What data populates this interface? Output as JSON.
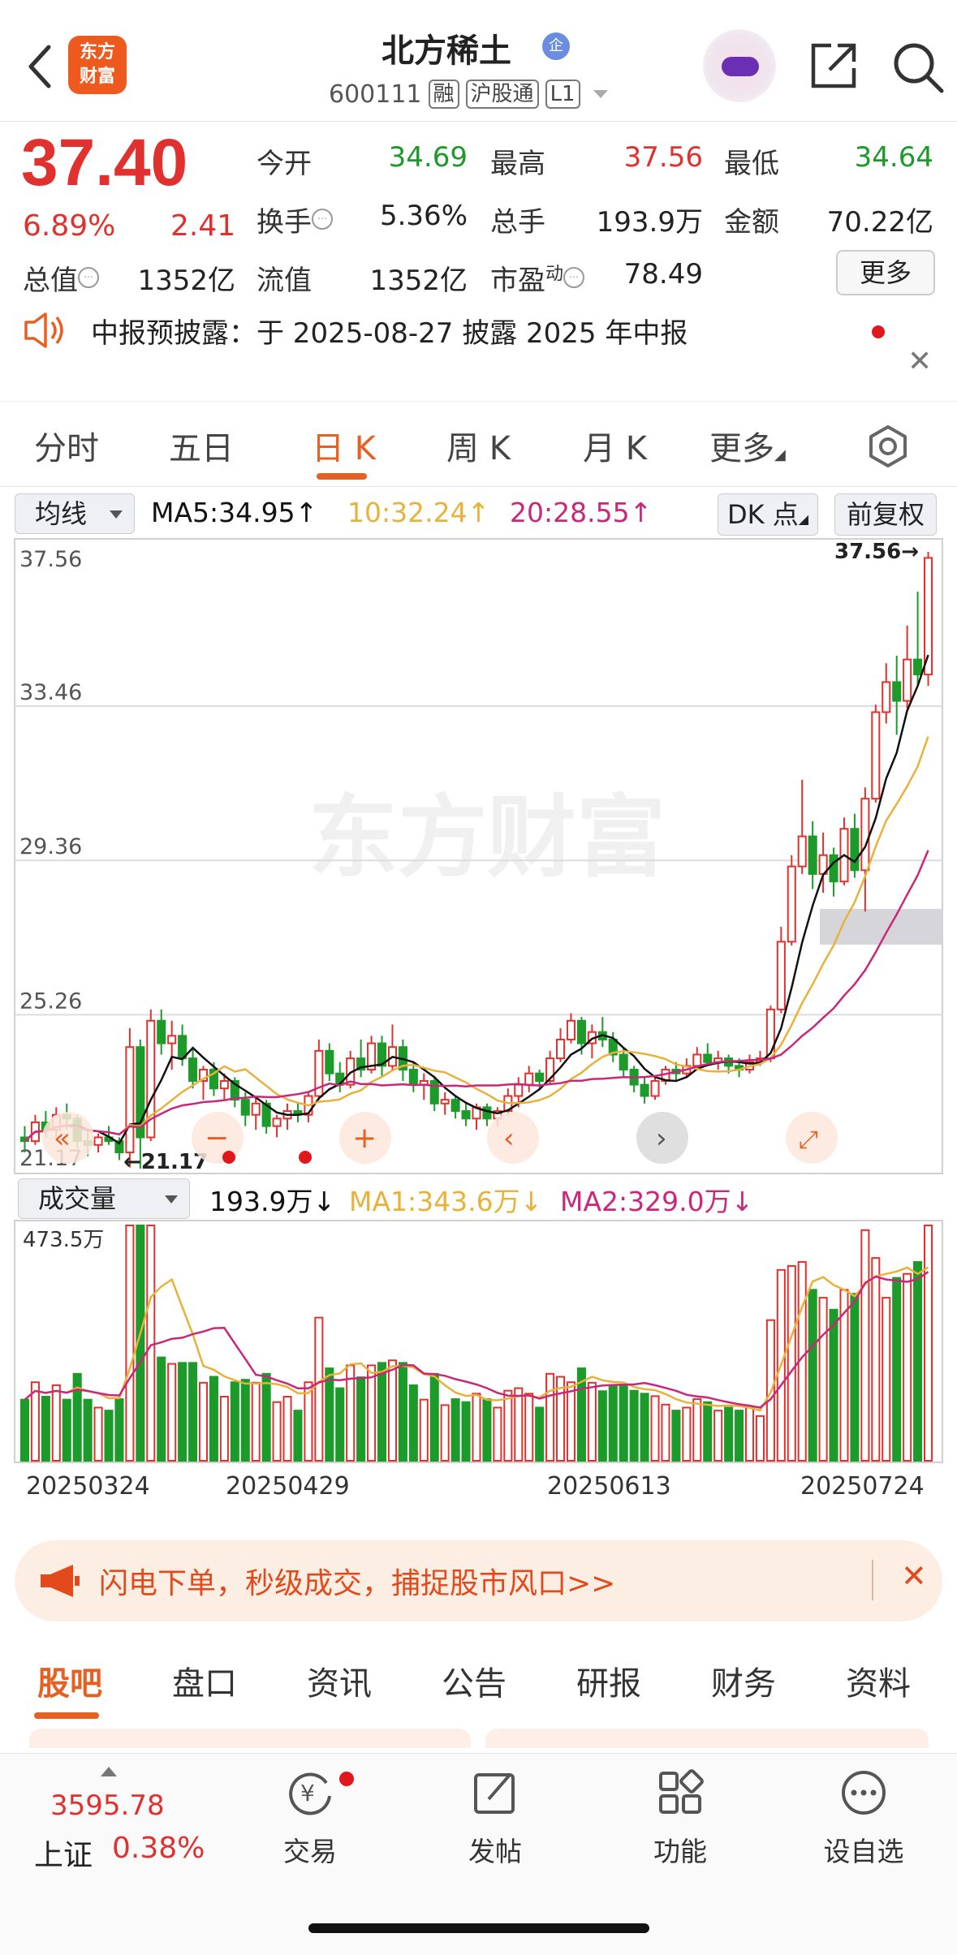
{
  "header": {
    "logo_text_line1": "东方",
    "logo_text_line2": "财富",
    "stock_name": "北方稀土",
    "cert_badge": "企",
    "stock_code": "600111",
    "tags": [
      "融",
      "沪股通",
      "L1"
    ]
  },
  "quote": {
    "price": "37.40",
    "change_pct": "6.89%",
    "change_amt": "2.41",
    "fields": [
      {
        "label": "今开",
        "value": "34.69",
        "color": "green"
      },
      {
        "label": "最高",
        "value": "37.56",
        "color": "red"
      },
      {
        "label": "最低",
        "value": "34.64",
        "color": "green"
      },
      {
        "label": "换手",
        "value": "5.36%",
        "color": "black"
      },
      {
        "label": "总手",
        "value": "193.9万",
        "color": "black"
      },
      {
        "label": "金额",
        "value": "70.22亿",
        "color": "black"
      },
      {
        "label": "总值",
        "value": "1352亿",
        "color": "black"
      },
      {
        "label": "流值",
        "value": "1352亿",
        "color": "black"
      },
      {
        "label": "市盈",
        "label_sup": "动",
        "value": "78.49",
        "color": "black"
      }
    ],
    "more_button": "更多"
  },
  "notice": {
    "text": "中报预披露：于 2025-08-27 披露 2025 年中报"
  },
  "chart_tabs": {
    "items": [
      "分时",
      "五日",
      "日 K",
      "周 K",
      "月 K",
      "更多"
    ],
    "active_index": 2
  },
  "ma_row": {
    "indicator": "均线",
    "ma5": "MA5:34.95",
    "ma10": "10:32.24",
    "ma20": "20:28.55",
    "dk_button": "DK 点",
    "adjust_button": "前复权",
    "colors": {
      "ma5": "#111111",
      "ma10": "#e8b23a",
      "ma20": "#c9287a"
    }
  },
  "kline": {
    "y_labels": [
      "37.56",
      "33.46",
      "29.36",
      "25.26",
      "21.17"
    ],
    "max_marker": "37.56",
    "min_marker": "21.17",
    "watermark": "东方财富",
    "up_color": "#e0312e",
    "down_color": "#1c9a2a"
  },
  "volume_row": {
    "indicator": "成交量",
    "value": "193.9万",
    "ma1": "MA1:343.6万",
    "ma2": "MA2:329.0万",
    "y_max_label": "473.5万"
  },
  "date_labels": [
    "20250324",
    "20250429",
    "20250613",
    "20250724"
  ],
  "chart_data": {
    "type": "candlestick",
    "ylim": [
      21.17,
      37.56
    ],
    "candles": [
      [
        22.0,
        22.3,
        21.6,
        21.9
      ],
      [
        21.9,
        22.6,
        21.8,
        22.4
      ],
      [
        22.4,
        22.7,
        22.0,
        22.2
      ],
      [
        22.2,
        22.8,
        22.0,
        22.6
      ],
      [
        22.6,
        22.9,
        22.2,
        22.5
      ],
      [
        22.5,
        22.6,
        21.7,
        21.9
      ],
      [
        21.9,
        22.2,
        21.5,
        21.8
      ],
      [
        21.8,
        22.1,
        21.6,
        22.0
      ],
      [
        22.0,
        22.3,
        21.8,
        21.9
      ],
      [
        21.9,
        22.0,
        21.4,
        21.6
      ],
      [
        21.6,
        24.9,
        21.2,
        24.4
      ],
      [
        24.4,
        24.6,
        21.17,
        22.0
      ],
      [
        22.0,
        25.4,
        21.9,
        25.1
      ],
      [
        25.1,
        25.4,
        24.2,
        24.5
      ],
      [
        24.5,
        25.1,
        23.8,
        24.7
      ],
      [
        24.7,
        25.0,
        23.9,
        24.1
      ],
      [
        24.1,
        24.4,
        23.3,
        23.5
      ],
      [
        23.5,
        23.9,
        23.0,
        23.8
      ],
      [
        23.8,
        24.0,
        23.1,
        23.3
      ],
      [
        23.3,
        23.7,
        23.0,
        23.5
      ],
      [
        23.5,
        23.6,
        22.8,
        23.0
      ],
      [
        23.0,
        23.2,
        22.3,
        22.6
      ],
      [
        22.6,
        23.1,
        22.2,
        22.9
      ],
      [
        22.9,
        23.0,
        22.1,
        22.3
      ],
      [
        22.3,
        22.6,
        22.0,
        22.5
      ],
      [
        22.5,
        22.9,
        22.2,
        22.7
      ],
      [
        22.7,
        22.9,
        22.4,
        22.6
      ],
      [
        22.6,
        23.2,
        22.4,
        23.1
      ],
      [
        23.1,
        24.6,
        23.0,
        24.3
      ],
      [
        24.3,
        24.5,
        23.5,
        23.7
      ],
      [
        23.7,
        24.0,
        23.2,
        23.4
      ],
      [
        23.4,
        24.3,
        23.3,
        24.1
      ],
      [
        24.1,
        24.6,
        23.6,
        23.8
      ],
      [
        23.8,
        24.7,
        23.7,
        24.5
      ],
      [
        24.5,
        24.7,
        23.6,
        23.9
      ],
      [
        23.9,
        25.0,
        23.8,
        24.4
      ],
      [
        24.4,
        24.6,
        23.5,
        23.8
      ],
      [
        23.8,
        24.0,
        23.2,
        23.4
      ],
      [
        23.4,
        23.7,
        23.0,
        23.5
      ],
      [
        23.5,
        23.6,
        22.7,
        22.9
      ],
      [
        22.9,
        23.2,
        22.6,
        23.0
      ],
      [
        23.0,
        23.1,
        22.5,
        22.7
      ],
      [
        22.7,
        22.9,
        22.3,
        22.5
      ],
      [
        22.5,
        22.9,
        22.2,
        22.8
      ],
      [
        22.8,
        22.9,
        22.3,
        22.5
      ],
      [
        22.5,
        22.8,
        22.3,
        22.7
      ],
      [
        22.7,
        23.3,
        22.6,
        23.1
      ],
      [
        23.1,
        23.6,
        22.8,
        23.4
      ],
      [
        23.4,
        23.9,
        23.2,
        23.7
      ],
      [
        23.7,
        23.8,
        23.3,
        23.5
      ],
      [
        23.5,
        24.3,
        23.4,
        24.1
      ],
      [
        24.1,
        24.9,
        24.0,
        24.6
      ],
      [
        24.6,
        25.3,
        24.5,
        25.1
      ],
      [
        25.1,
        25.2,
        24.2,
        24.5
      ],
      [
        24.5,
        25.0,
        24.1,
        24.8
      ],
      [
        24.8,
        25.2,
        24.4,
        24.6
      ],
      [
        24.6,
        24.8,
        24.0,
        24.2
      ],
      [
        24.2,
        24.4,
        23.6,
        23.8
      ],
      [
        23.8,
        23.9,
        23.2,
        23.4
      ],
      [
        23.4,
        23.6,
        22.9,
        23.1
      ],
      [
        23.1,
        23.6,
        23.0,
        23.5
      ],
      [
        23.5,
        23.9,
        23.4,
        23.8
      ],
      [
        23.8,
        24.0,
        23.5,
        23.7
      ],
      [
        23.7,
        24.1,
        23.6,
        23.9
      ],
      [
        23.9,
        24.4,
        23.8,
        24.2
      ],
      [
        24.2,
        24.5,
        23.9,
        24.0
      ],
      [
        24.0,
        24.3,
        23.8,
        24.1
      ],
      [
        24.1,
        24.2,
        23.7,
        23.9
      ],
      [
        23.9,
        24.1,
        23.6,
        23.8
      ],
      [
        23.8,
        24.2,
        23.7,
        24.0
      ],
      [
        24.0,
        24.3,
        23.9,
        24.1
      ],
      [
        24.1,
        25.5,
        24.0,
        25.4
      ],
      [
        25.4,
        27.6,
        25.3,
        27.2
      ],
      [
        27.2,
        29.5,
        27.1,
        29.2
      ],
      [
        29.2,
        31.5,
        29.0,
        30.0
      ],
      [
        30.0,
        30.4,
        28.6,
        29.0
      ],
      [
        29.0,
        30.1,
        28.5,
        29.5
      ],
      [
        29.5,
        29.7,
        28.4,
        28.8
      ],
      [
        28.8,
        30.5,
        28.7,
        30.2
      ],
      [
        30.2,
        30.6,
        28.9,
        29.1
      ],
      [
        29.1,
        31.3,
        28.0,
        31.0
      ],
      [
        31.0,
        33.5,
        30.9,
        33.3
      ],
      [
        33.3,
        34.6,
        33.0,
        34.1
      ],
      [
        34.1,
        34.8,
        32.7,
        33.6
      ],
      [
        33.6,
        35.6,
        33.4,
        34.7
      ],
      [
        34.7,
        36.5,
        34.0,
        34.3
      ],
      [
        34.3,
        37.56,
        34.0,
        37.4
      ]
    ],
    "volume_ylim": [
      0,
      473.5
    ],
    "volume_max_label": "473.5万"
  }
}
